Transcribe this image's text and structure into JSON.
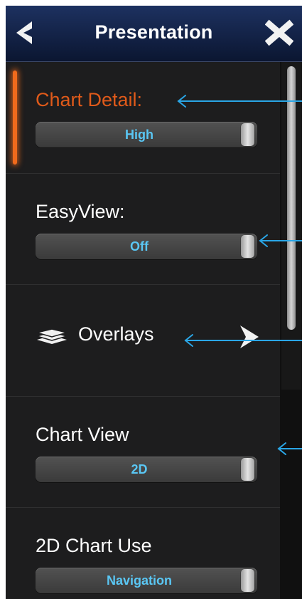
{
  "header": {
    "title": "Presentation",
    "back_icon": "chevron-left-icon",
    "close_icon": "close-icon",
    "background": "#0b1631"
  },
  "settings": [
    {
      "label": "Chart Detail:",
      "value": "High",
      "selected": true
    },
    {
      "label": "EasyView:",
      "value": "Off",
      "selected": false
    },
    {
      "label": "Overlays",
      "type": "submenu",
      "icon": "layers-icon",
      "action_icon": "chevron-right-icon"
    },
    {
      "label": "Chart View",
      "value": "2D",
      "selected": false
    },
    {
      "label": "2D Chart Use",
      "value": "Navigation",
      "selected": false
    }
  ],
  "colors": {
    "selected_label": "#e05a1a",
    "selected_indicator": "#f06a1c",
    "value_text": "#5ac7f4",
    "callout_arrow": "#2aa6e6"
  }
}
